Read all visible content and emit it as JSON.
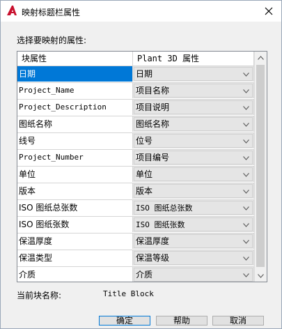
{
  "window": {
    "title": "映射标题栏属性",
    "app_icon": "autocad-a-icon",
    "close_icon": "close-icon"
  },
  "prompt": "选择要映射的属性:",
  "table": {
    "col1_header": "块属性",
    "col2_header": "Plant 3D 属性",
    "rows": [
      {
        "block": "日期",
        "plant": "日期"
      },
      {
        "block": "Project_Name",
        "plant": "项目名称"
      },
      {
        "block": "Project_Description",
        "plant": "项目说明"
      },
      {
        "block": "图纸名称",
        "plant": "图纸名称"
      },
      {
        "block": "线号",
        "plant": "位号"
      },
      {
        "block": "Project_Number",
        "plant": "项目编号"
      },
      {
        "block": "单位",
        "plant": "单位"
      },
      {
        "block": "版本",
        "plant": "版本"
      },
      {
        "block": "ISO 图纸总张数",
        "plant": "ISO 图纸总张数"
      },
      {
        "block": "ISO 图纸张数",
        "plant": "ISO 图纸张数"
      },
      {
        "block": "保温厚度",
        "plant": "保温厚度"
      },
      {
        "block": "保温类型",
        "plant": "保温等级"
      },
      {
        "block": "介质",
        "plant": "介质"
      },
      {
        "block": "",
        "plant": ""
      }
    ],
    "selected_index": 0
  },
  "footer": {
    "current_block_label": "当前块名称:",
    "current_block_value": "Title Block"
  },
  "buttons": {
    "ok": "确定",
    "help": "帮助",
    "cancel": "取消"
  },
  "colors": {
    "selection": "#0078d7",
    "logo_red": "#c8102e"
  }
}
